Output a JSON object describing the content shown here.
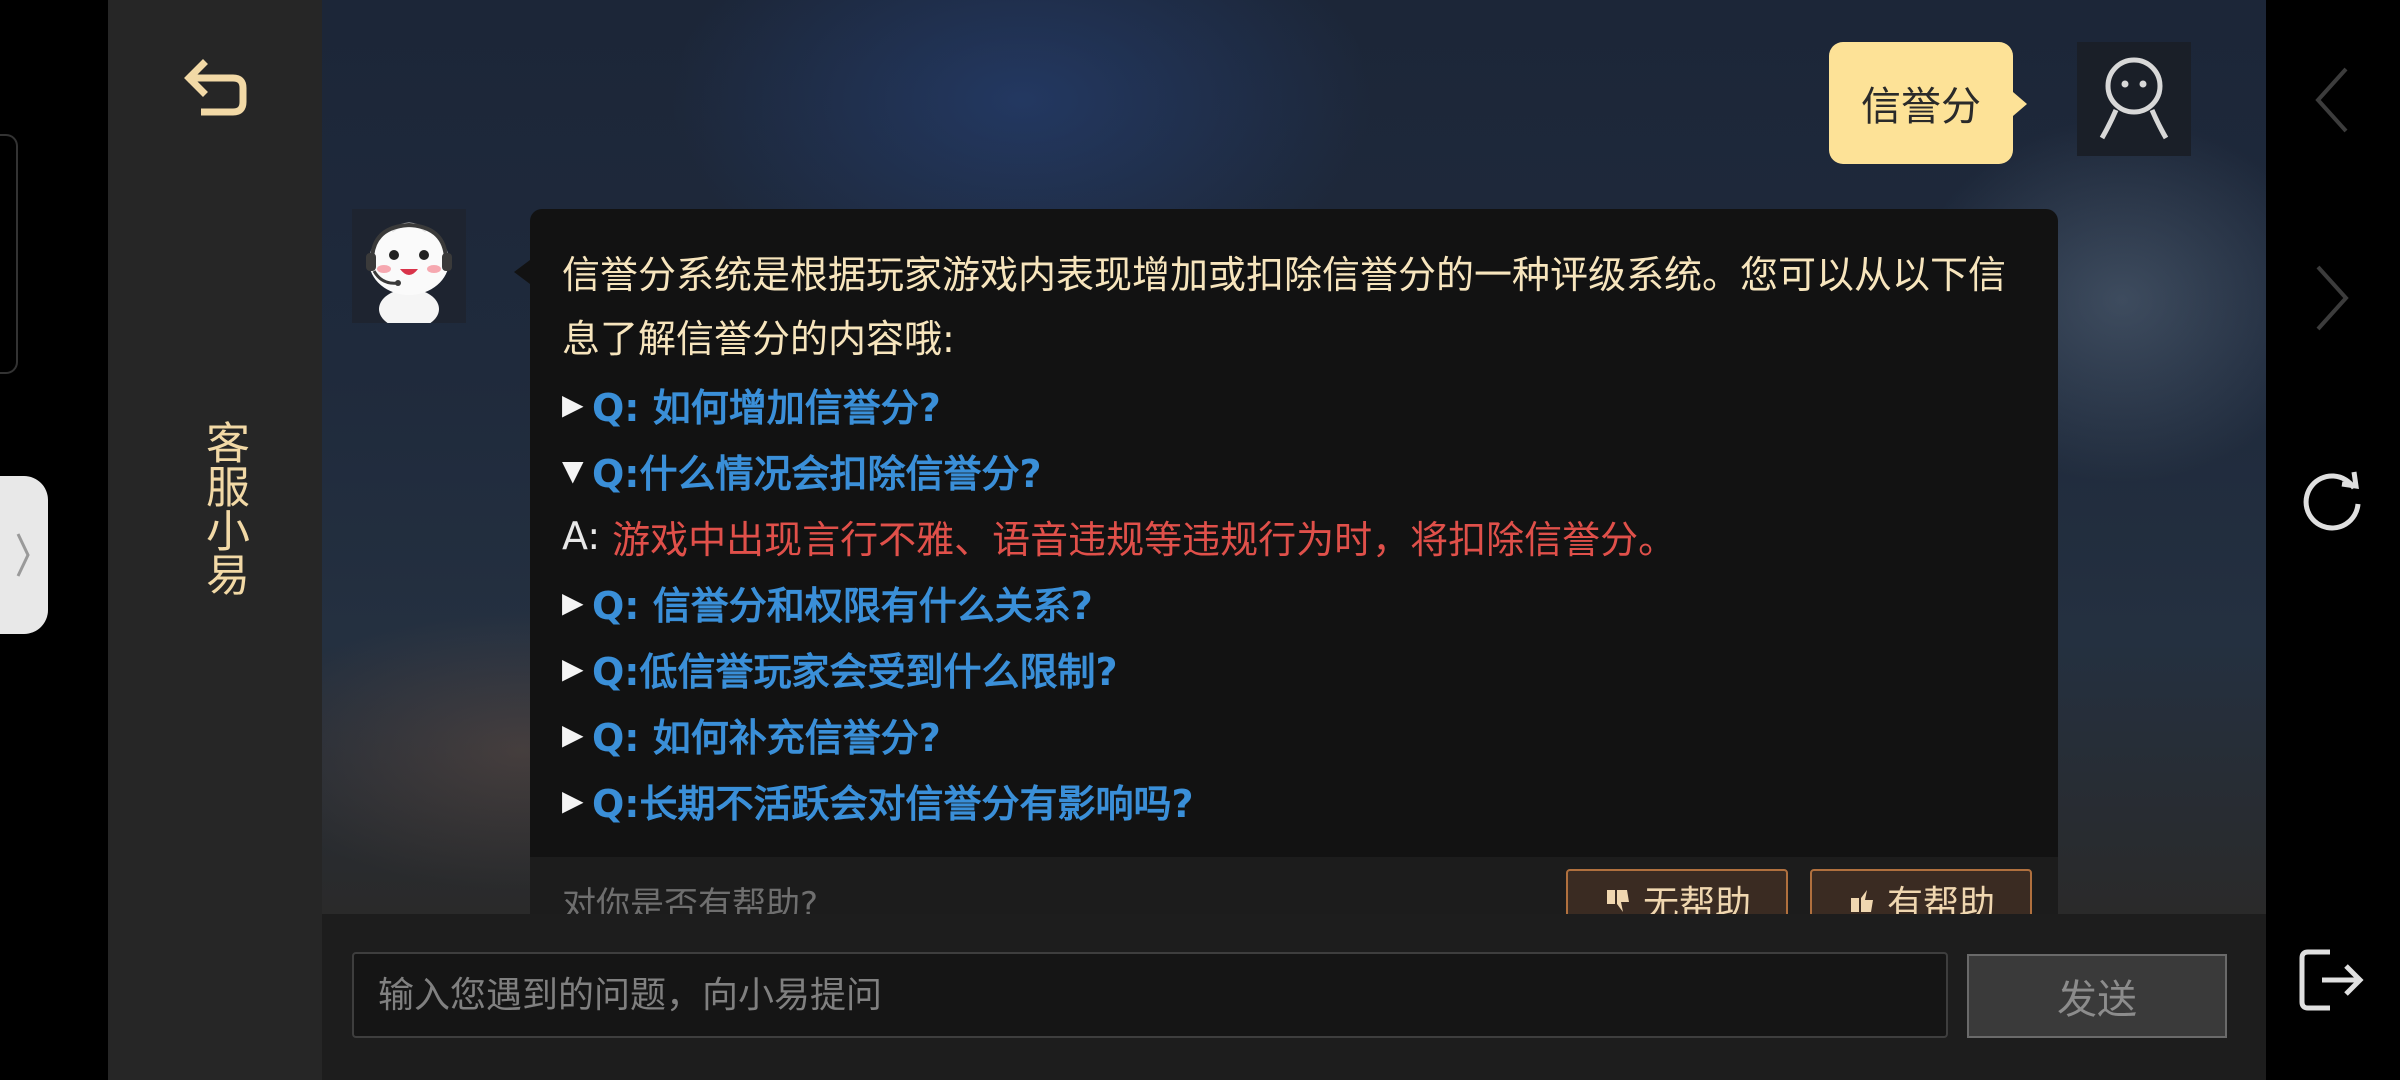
{
  "sidebar": {
    "title": "客服小易"
  },
  "chat": {
    "user_message": "信誉分",
    "bot_intro": "信誉分系统是根据玩家游戏内表现增加或扣除信誉分的一种评级系统。您可以从以下信息了解信誉分的内容哦:",
    "faq": [
      {
        "arrow": "▶",
        "question": "Q: 如何增加信誉分?"
      },
      {
        "arrow": "▼",
        "question": "Q:什么情况会扣除信誉分?"
      },
      {
        "arrow": "▶",
        "question": "Q: 信誉分和权限有什么关系?"
      },
      {
        "arrow": "▶",
        "question": "Q:低信誉玩家会受到什么限制?"
      },
      {
        "arrow": "▶",
        "question": "Q: 如何补充信誉分?"
      },
      {
        "arrow": "▶",
        "question": "Q:长期不活跃会对信誉分有影响吗?"
      }
    ],
    "answer": {
      "label": "A:",
      "text": "游戏中出现言行不雅、语音违规等违规行为时，将扣除信誉分。"
    },
    "feedback": {
      "question": "对你是否有帮助?",
      "not_helpful": "无帮助",
      "helpful": "有帮助"
    }
  },
  "input": {
    "placeholder": "输入您遇到的问题，向小易提问",
    "send_label": "发送"
  },
  "colors": {
    "accent_gold": "#f2d9a6",
    "question_blue": "#3a8fd8",
    "answer_red": "#e0504a",
    "user_bubble": "#fde297"
  },
  "icons": [
    "back-arrow-icon",
    "user-avatar-icon",
    "bot-avatar-icon",
    "chevron-left-icon",
    "chevron-right-icon",
    "refresh-icon",
    "exit-icon",
    "thumbs-down-icon",
    "thumbs-up-icon",
    "panel-handle-icon"
  ]
}
